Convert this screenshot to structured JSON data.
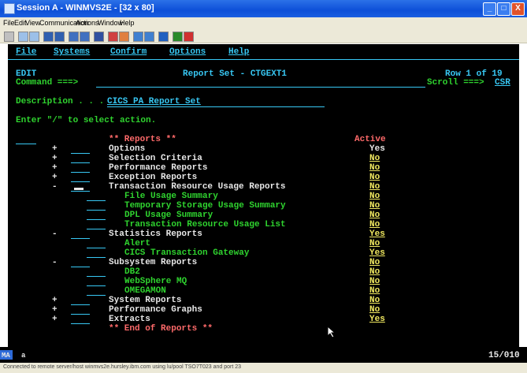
{
  "window": {
    "title": "Session A - WINMVS2E - [32 x 80]",
    "min": "_",
    "max": "□",
    "close": "X"
  },
  "menu": [
    "File",
    "Edit",
    "View",
    "Communication",
    "Actions",
    "Window",
    "Help"
  ],
  "ispf_menu": [
    "File",
    "Systems",
    "Confirm",
    "Options",
    "Help"
  ],
  "header": {
    "mode": "EDIT",
    "title": "Report Set - CTGEXT1",
    "row_info": "Row 1 of 19",
    "command_label": "Command ===>",
    "scroll_label": "Scroll ===>",
    "scroll_value": "CSR"
  },
  "description": {
    "label": "Description . . .",
    "value": "CICS PA Report Set"
  },
  "instruction": "Enter \"/\" to select action.",
  "table": {
    "header": "** Reports **",
    "active_header": "Active",
    "footer": "** End of Reports **",
    "rows": [
      {
        "exp": "+",
        "name": "Options",
        "active": "Yes"
      },
      {
        "exp": "+",
        "name": "Selection Criteria",
        "active": "No"
      },
      {
        "exp": "+",
        "name": "Performance Reports",
        "active": "No"
      },
      {
        "exp": "+",
        "name": "Exception Reports",
        "active": "No"
      },
      {
        "exp": "-",
        "name": "Transaction Resource Usage Reports",
        "active": "No"
      },
      {
        "exp": "",
        "name": "File Usage Summary",
        "active": "No"
      },
      {
        "exp": "",
        "name": "Temporary Storage Usage Summary",
        "active": "No"
      },
      {
        "exp": "",
        "name": "DPL Usage Summary",
        "active": "No"
      },
      {
        "exp": "",
        "name": "Transaction Resource Usage List",
        "active": "No"
      },
      {
        "exp": "-",
        "name": "Statistics Reports",
        "active": "Yes"
      },
      {
        "exp": "",
        "name": "Alert",
        "active": "No"
      },
      {
        "exp": "",
        "name": "CICS Transaction Gateway",
        "active": "Yes"
      },
      {
        "exp": "-",
        "name": "Subsystem Reports",
        "active": "No"
      },
      {
        "exp": "",
        "name": "DB2",
        "active": "No"
      },
      {
        "exp": "",
        "name": "WebSphere MQ",
        "active": "No"
      },
      {
        "exp": "",
        "name": "OMEGAMON",
        "active": "No"
      },
      {
        "exp": "+",
        "name": "System Reports",
        "active": "No"
      },
      {
        "exp": "+",
        "name": "Performance Graphs",
        "active": "No"
      },
      {
        "exp": "+",
        "name": "Extracts",
        "active": "Yes"
      }
    ]
  },
  "status": {
    "left": "MA",
    "session": "a",
    "cursor_pos": "15/010"
  },
  "bottom": "Connected to remote server/host winmvs2e.hursley.ibm.com using lu/pool TSO7T023 and port 23"
}
